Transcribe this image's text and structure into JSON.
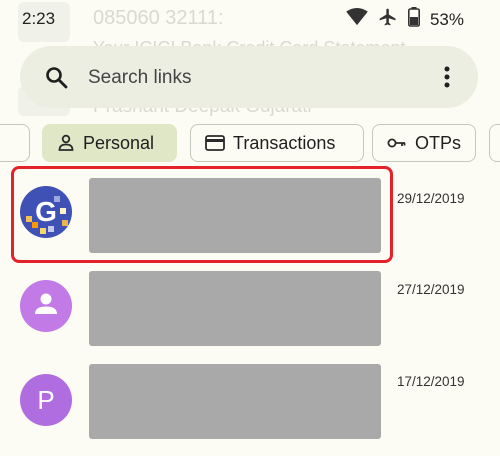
{
  "status_bar": {
    "time": "2:23",
    "battery": "53%",
    "icons": [
      "wifi-icon",
      "airplane-icon",
      "battery-icon"
    ]
  },
  "background": {
    "line1": "085060 32111:",
    "line2": "Your ICICI Bank Credit Card Statement",
    "line3": "Prashant Deepak Gujarati"
  },
  "search": {
    "placeholder": "Search links",
    "value": ""
  },
  "chips": [
    {
      "label": "Personal",
      "icon": "person-icon",
      "selected": true
    },
    {
      "label": "Transactions",
      "icon": "card-icon",
      "selected": false
    },
    {
      "label": "OTPs",
      "icon": "key-icon",
      "selected": false
    }
  ],
  "messages": [
    {
      "avatar_type": "logo",
      "avatar_letter": "G",
      "date": "29/12/2019",
      "highlighted": true
    },
    {
      "avatar_type": "person-icon",
      "avatar_letter": "",
      "date": "27/12/2019",
      "highlighted": false
    },
    {
      "avatar_type": "letter",
      "avatar_letter": "P",
      "date": "17/12/2019",
      "highlighted": false
    }
  ],
  "colors": {
    "background": "#fdfcf4",
    "search_bar": "#eceee2",
    "chip_selected": "#dfe7c6",
    "redacted_block": "#a9a9a9",
    "highlight_border": "#e5222a",
    "avatar_logo": "#3f51b5",
    "avatar_person": "#c27be6",
    "avatar_letter": "#b06de0"
  }
}
